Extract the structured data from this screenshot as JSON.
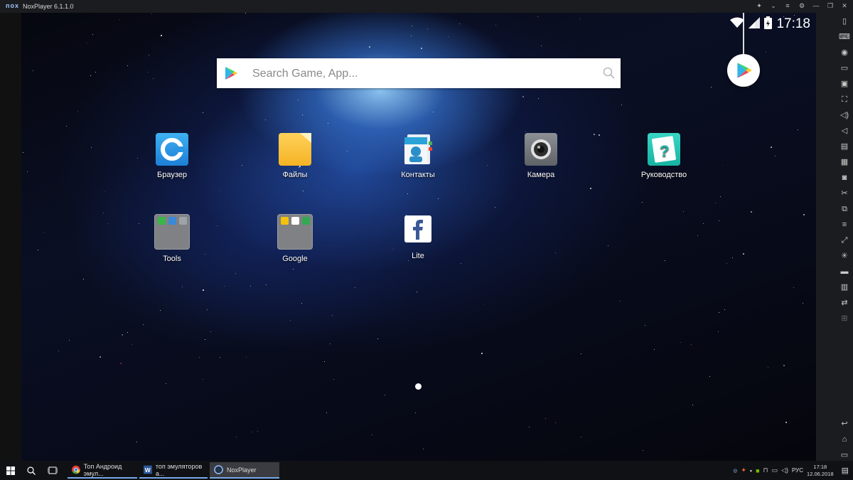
{
  "window": {
    "logo_text": "nox",
    "title": "NoxPlayer 6.1.1.0"
  },
  "status_bar": {
    "time": "17:18",
    "icons": [
      "wifi-icon",
      "signal-icon",
      "battery-charging-icon"
    ]
  },
  "search": {
    "placeholder": "Search Game, App..."
  },
  "apps": [
    {
      "label": "Браузер",
      "icon": "browser-icon"
    },
    {
      "label": "Файлы",
      "icon": "files-icon"
    },
    {
      "label": "Контакты",
      "icon": "contacts-icon"
    },
    {
      "label": "Камера",
      "icon": "camera-icon"
    },
    {
      "label": "Руководство",
      "icon": "guide-icon"
    },
    {
      "label": "Tools",
      "icon": "tools-folder-icon"
    },
    {
      "label": "Google",
      "icon": "google-folder-icon"
    },
    {
      "label": "Lite",
      "icon": "facebook-lite-icon"
    }
  ],
  "sidebar_tools": [
    "phone-icon",
    "keyboard-icon",
    "location-icon",
    "screen-icon",
    "screenshot-icon",
    "fullscreen-icon",
    "volume-up-icon",
    "volume-down-icon",
    "apk-install-icon",
    "shared-folder-icon",
    "camera-icon",
    "cut-icon",
    "multi-instance-icon",
    "menu-icon",
    "link-icon",
    "loading-icon",
    "video-record-icon",
    "macro-icon",
    "sync-icon",
    "settings-grid-icon",
    "back-icon",
    "home-icon",
    "recent-apps-icon"
  ],
  "taskbar": {
    "tasks": [
      {
        "label": "Топ Андроид эмул...",
        "icon": "chrome-icon"
      },
      {
        "label": "топ эмуляторов а...",
        "icon": "word-icon"
      },
      {
        "label": "NoxPlayer",
        "icon": "nox-icon"
      }
    ],
    "language": "РУС",
    "time": "17:18",
    "date": "12.06.2018"
  },
  "colors": {
    "titlebar": "#1b1c1f",
    "taskbar": "#101114",
    "accent_blue": "#76a9e8"
  }
}
